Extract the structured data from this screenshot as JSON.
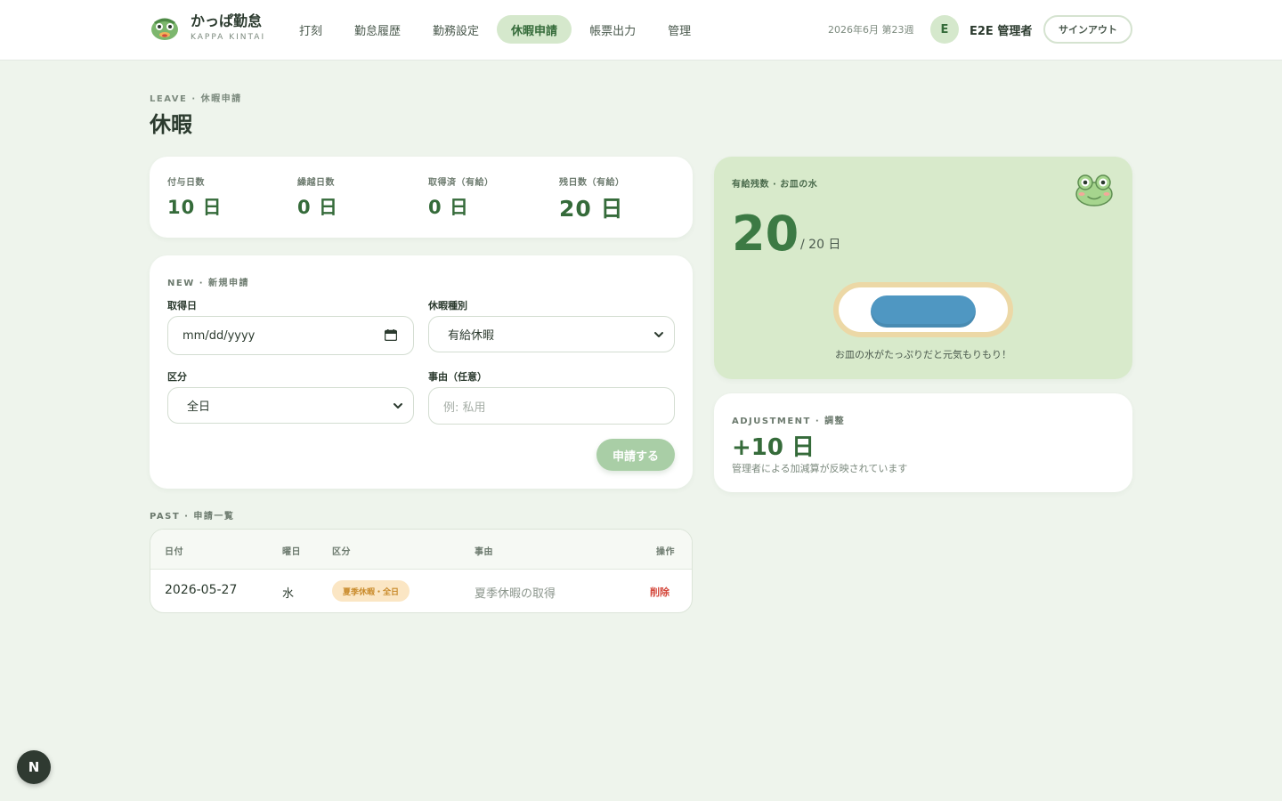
{
  "app": {
    "title": "かっぱ勤怠",
    "subtitle": "KAPPA KINTAI"
  },
  "nav": {
    "items": [
      {
        "label": "打刻",
        "active": false
      },
      {
        "label": "勤怠履歴",
        "active": false
      },
      {
        "label": "勤務設定",
        "active": false
      },
      {
        "label": "休暇申請",
        "active": true
      },
      {
        "label": "帳票出力",
        "active": false
      },
      {
        "label": "管理",
        "active": false
      }
    ]
  },
  "header": {
    "week": "2026年6月 第23週",
    "avatar_initial": "E",
    "user_name": "E2E 管理者",
    "signout_label": "サインアウト"
  },
  "page": {
    "eyebrow": "LEAVE · 休暇申請",
    "title": "休暇"
  },
  "summary": {
    "stats": [
      {
        "label": "付与日数",
        "value": "10 日"
      },
      {
        "label": "繰越日数",
        "value": "0 日"
      },
      {
        "label": "取得済（有給）",
        "value": "0 日"
      },
      {
        "label": "残日数（有給）",
        "value": "20 日"
      }
    ]
  },
  "form": {
    "eyebrow": "NEW · 新規申請",
    "date_label": "取得日",
    "date_value": "mm/dd/yyyy",
    "type_label": "休暇種別",
    "type_value": "有給休暇",
    "division_label": "区分",
    "division_value": "全日",
    "reason_label": "事由（任意）",
    "reason_placeholder": "例: 私用",
    "submit_label": "申請する"
  },
  "past": {
    "eyebrow": "PAST · 申請一覧",
    "columns": [
      "日付",
      "曜日",
      "区分",
      "事由",
      "操作"
    ],
    "rows": [
      {
        "date": "2026-05-27",
        "weekday": "水",
        "division": "夏季休暇・全日",
        "reason": "夏季休暇の取得",
        "action": "削除"
      }
    ]
  },
  "balance": {
    "label": "有給残数 · お皿の水",
    "remaining": "20",
    "of_total": "/ 20 日",
    "water_level": 1.0,
    "caption": "お皿の水がたっぷりだと元気もりもり！"
  },
  "adjustment": {
    "eyebrow": "ADJUSTMENT · 調整",
    "value": "+10 日",
    "note": "管理者による加減算が反映されています"
  },
  "dev_badge": "N",
  "colors": {
    "accent": "#356b3a",
    "background": "#eef4ec",
    "balance_card": "#d8eacb",
    "water": "#4f97c2",
    "delete": "#d4483c",
    "badge_bg": "#fbe6c4"
  }
}
